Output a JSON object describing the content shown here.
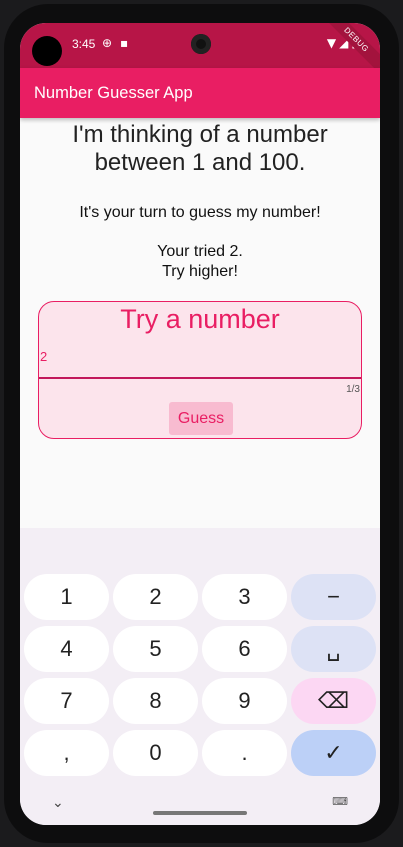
{
  "status_bar": {
    "time": "3:45",
    "debug_label": "DEBUG"
  },
  "app_bar": {
    "title": "Number Guesser App"
  },
  "main": {
    "headline_line1": "I'm thinking of a number",
    "headline_line2": "between 1 and 100.",
    "prompt": "It's your turn to guess my number!",
    "feedback_line1": "Your tried 2.",
    "feedback_line2": "Try higher!"
  },
  "card": {
    "title": "Try a number",
    "input_value": "2",
    "counter": "1/3",
    "guess_label": "Guess"
  },
  "keyboard": {
    "rows": [
      [
        "1",
        "2",
        "3",
        "−"
      ],
      [
        "4",
        "5",
        "6",
        "␣"
      ],
      [
        "7",
        "8",
        "9",
        "⌫"
      ],
      [
        ",",
        "0",
        ".",
        "✓"
      ]
    ]
  },
  "colors": {
    "accent": "#e91e63",
    "status_bar": "#b71547",
    "card_bg": "#fce4ec",
    "button_bg": "#f8bbd0"
  },
  "icons": {
    "status": [
      "gps-icon",
      "sim-icon",
      "wifi-icon",
      "signal-icon",
      "battery-icon"
    ],
    "keyboard": [
      "minus-key",
      "space-key",
      "backspace-icon",
      "checkmark-icon"
    ],
    "nav": [
      "chevron-down-icon",
      "keyboard-icon"
    ]
  }
}
